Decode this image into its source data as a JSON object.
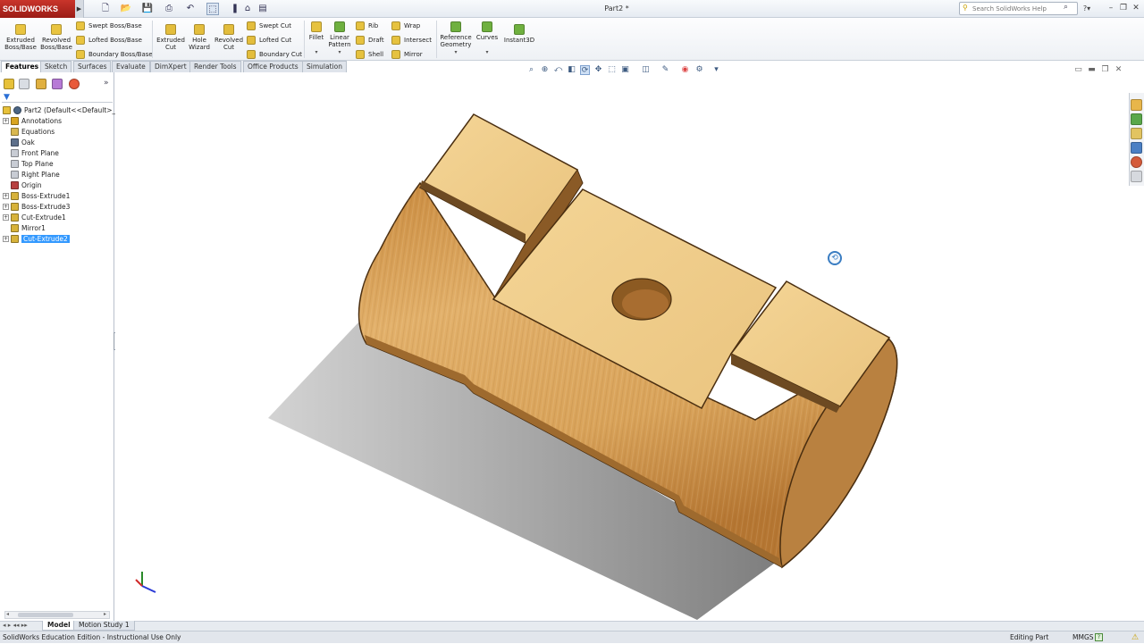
{
  "app": {
    "brand": "SOLIDWORKS",
    "document_title": "Part2 *",
    "help_search_placeholder": "Search SolidWorks Help"
  },
  "ribbon": {
    "extruded_boss": [
      "Extruded",
      "Boss/Base"
    ],
    "revolved_boss": [
      "Revolved",
      "Boss/Base"
    ],
    "swept_boss": "Swept Boss/Base",
    "lofted_boss": "Lofted Boss/Base",
    "boundary_boss": "Boundary Boss/Base",
    "extruded_cut": [
      "Extruded",
      "Cut"
    ],
    "hole_wizard": [
      "Hole",
      "Wizard"
    ],
    "revolved_cut": [
      "Revolved",
      "Cut"
    ],
    "swept_cut": "Swept Cut",
    "lofted_cut": "Lofted Cut",
    "boundary_cut": "Boundary Cut",
    "fillet": "Fillet",
    "linear_pattern": [
      "Linear",
      "Pattern"
    ],
    "rib": "Rib",
    "draft": "Draft",
    "shell": "Shell",
    "wrap": "Wrap",
    "intersect": "Intersect",
    "mirror": "Mirror",
    "reference_geometry": [
      "Reference",
      "Geometry"
    ],
    "curves": "Curves",
    "instant3d": "Instant3D"
  },
  "tabs": [
    "Features",
    "Sketch",
    "Surfaces",
    "Evaluate",
    "DimXpert",
    "Render Tools",
    "Office Products",
    "Simulation"
  ],
  "active_tab": "Features",
  "feature_tree": {
    "root": "Part2  (Default<<Default>_D",
    "items": [
      {
        "label": "Annotations",
        "expandable": true,
        "icon": "annotations-icon",
        "color": "#d9a520"
      },
      {
        "label": "Equations",
        "expandable": false,
        "icon": "equations-icon",
        "color": "#d9b850"
      },
      {
        "label": "Oak",
        "expandable": false,
        "icon": "material-icon",
        "color": "#5d6f8a"
      },
      {
        "label": "Front Plane",
        "expandable": false,
        "icon": "plane-icon",
        "color": "#c8ccd4"
      },
      {
        "label": "Top Plane",
        "expandable": false,
        "icon": "plane-icon",
        "color": "#c8ccd4"
      },
      {
        "label": "Right Plane",
        "expandable": false,
        "icon": "plane-icon",
        "color": "#c8ccd4"
      },
      {
        "label": "Origin",
        "expandable": false,
        "icon": "origin-icon",
        "color": "#b84040"
      },
      {
        "label": "Boss-Extrude1",
        "expandable": true,
        "icon": "extrude-icon",
        "color": "#d7b23a"
      },
      {
        "label": "Boss-Extrude3",
        "expandable": true,
        "icon": "extrude-icon",
        "color": "#d7b23a"
      },
      {
        "label": "Cut-Extrude1",
        "expandable": true,
        "icon": "cut-extrude-icon",
        "color": "#d7b23a"
      },
      {
        "label": "Mirror1",
        "expandable": false,
        "icon": "mirror-icon",
        "color": "#d7b23a"
      },
      {
        "label": "Cut-Extrude2",
        "expandable": true,
        "icon": "cut-extrude-icon",
        "color": "#d7b23a",
        "selected": true
      }
    ]
  },
  "bottom_tabs": [
    "Model",
    "Motion Study 1"
  ],
  "status": {
    "edition": "SolidWorks Education Edition - Instructional Use Only",
    "mode": "Editing Part",
    "units": "MMGS"
  },
  "colors": {
    "brand_red": "#b8261e",
    "wood_light": "#f0cc8a",
    "wood_mid": "#d9a45c",
    "wood_dark": "#9a6a30",
    "selection": "#3399ff"
  }
}
